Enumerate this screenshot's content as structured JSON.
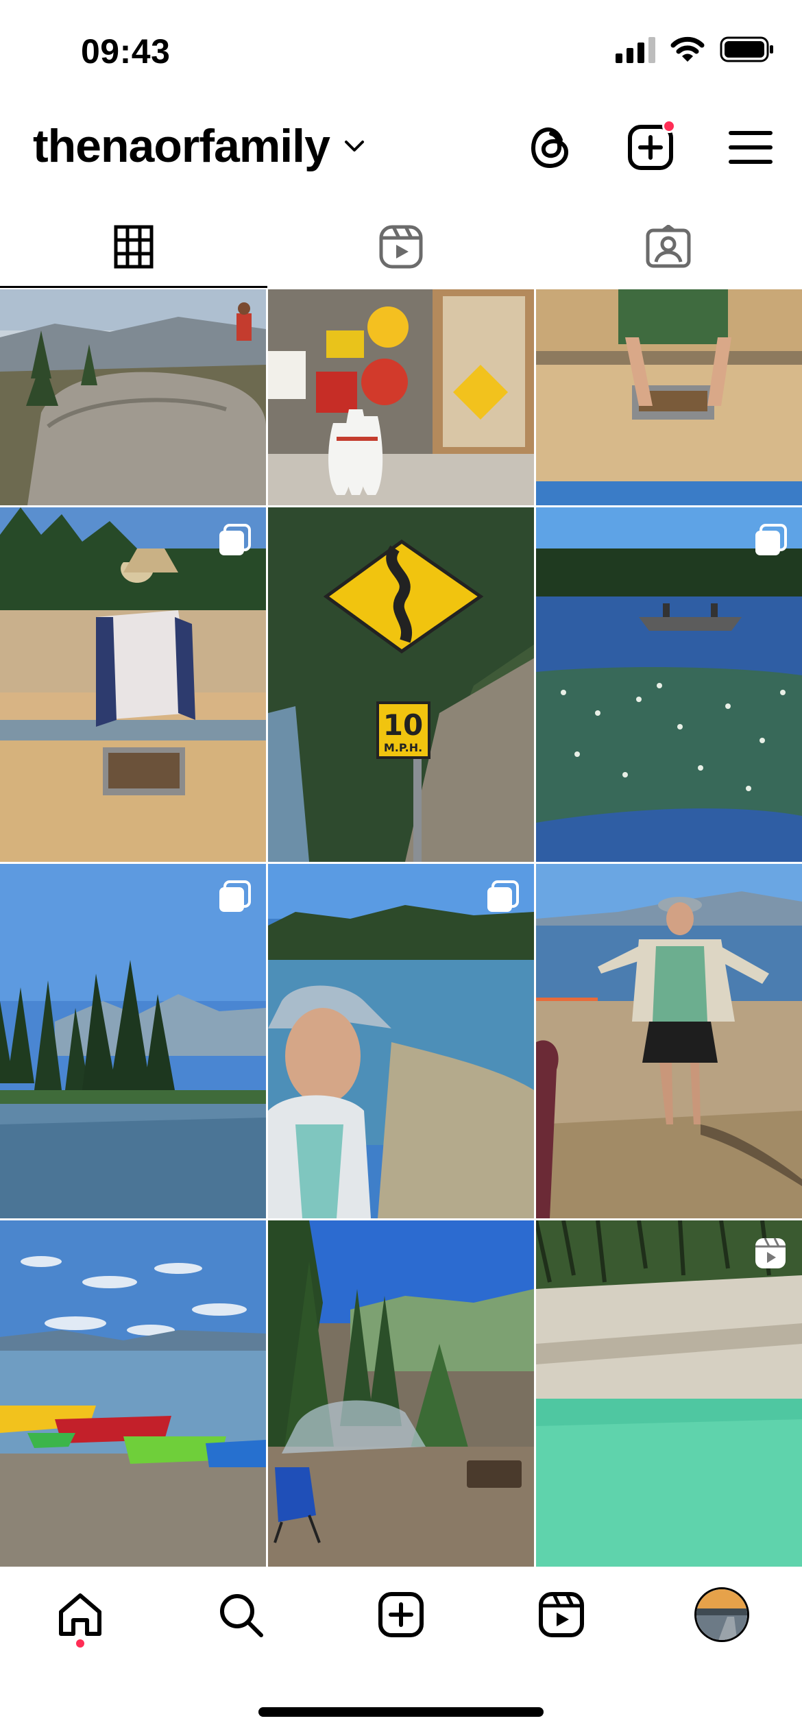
{
  "status_bar": {
    "time": "09:43",
    "icons": [
      "cellular-signal-icon",
      "wifi-icon",
      "battery-icon"
    ]
  },
  "header": {
    "username": "thenaorfamily",
    "icons": [
      "chevron-down-icon",
      "threads-icon",
      "create-post-icon",
      "menu-icon"
    ],
    "notification_color": "#ff2d55"
  },
  "tabs": [
    {
      "name": "posts-grid",
      "icon": "grid-icon",
      "active": true
    },
    {
      "name": "reels",
      "icon": "reels-icon",
      "active": false
    },
    {
      "name": "tagged",
      "icon": "tagged-person-icon",
      "active": false
    }
  ],
  "posts": [
    {
      "subject": "rocky overlook with pine trees",
      "badge": null
    },
    {
      "subject": "bowling pins and vintage signs",
      "badge": null
    },
    {
      "subject": "gold panning sluice",
      "badge": null
    },
    {
      "subject": "child panning for gold",
      "badge": "carousel-icon"
    },
    {
      "subject": "yellow curvy road sign 10 M.P.H.",
      "badge": null
    },
    {
      "subject": "lake with lily pads and boat",
      "badge": "carousel-icon"
    },
    {
      "subject": "mountain lake with evergreens",
      "badge": "carousel-icon"
    },
    {
      "subject": "selfie by the lake",
      "badge": "carousel-icon"
    },
    {
      "subject": "woman on lakeshore",
      "badge": null
    },
    {
      "subject": "kayaks on the beach",
      "badge": null
    },
    {
      "subject": "campsite with forest view",
      "badge": null
    },
    {
      "subject": "turquoise water below cliff",
      "badge": "reel-icon"
    }
  ],
  "sign": {
    "number": "10",
    "unit": "M.P.H."
  },
  "bottom_nav": [
    {
      "name": "home",
      "icon": "home-icon",
      "active": true
    },
    {
      "name": "search",
      "icon": "search-icon",
      "active": false
    },
    {
      "name": "create",
      "icon": "create-icon",
      "active": false
    },
    {
      "name": "reels",
      "icon": "reels-icon",
      "active": false
    },
    {
      "name": "profile",
      "icon": "profile-avatar",
      "active": false
    }
  ],
  "colors": {
    "accent": "#ff2d55",
    "text": "#000000",
    "background": "#ffffff"
  }
}
